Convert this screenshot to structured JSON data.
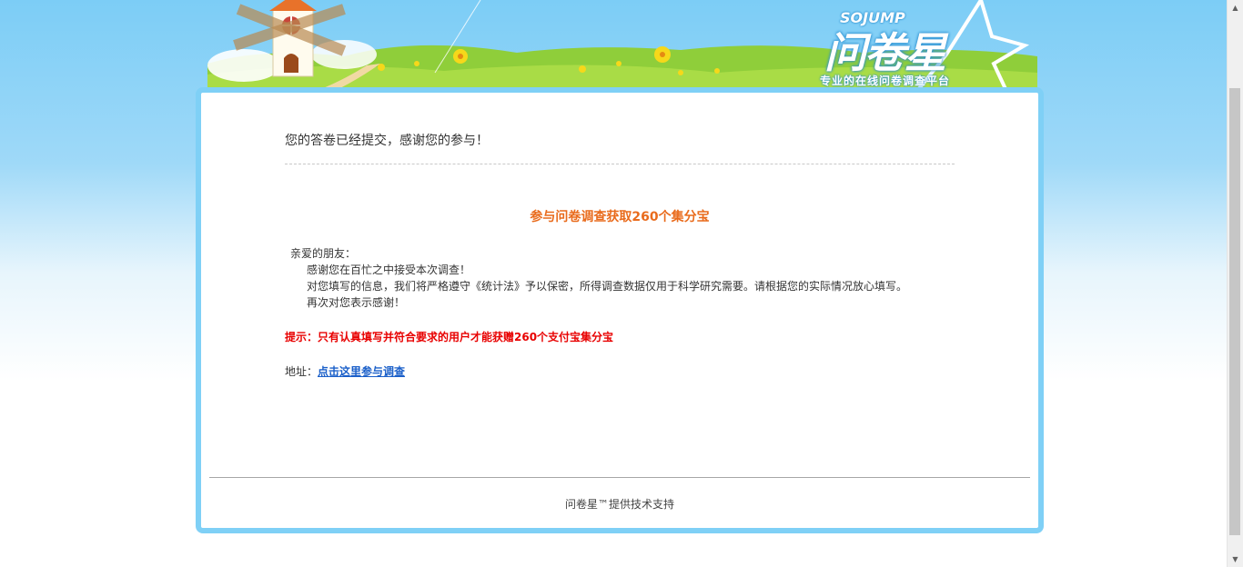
{
  "header": {
    "logo_en": "SOJUMP",
    "logo_cn": "问卷星",
    "logo_tagline": "专业的在线问卷调查平台"
  },
  "main": {
    "submitted_message": "您的答卷已经提交，感谢您的参与！",
    "promo_title": "参与问卷调查获取260个集分宝",
    "letter": {
      "greeting": "亲爱的朋友：",
      "line1": "感谢您在百忙之中接受本次调查！",
      "line2": "对您填写的信息，我们将严格遵守《统计法》予以保密，所得调查数据仅用于科学研究需要。请根据您的实际情况放心填写。",
      "line3": "再次对您表示感谢！"
    },
    "tip": "提示：只有认真填写并符合要求的用户才能获赠260个支付宝集分宝",
    "address_label": "地址：",
    "address_link": "点击这里参与调查"
  },
  "footer": {
    "text": "问卷星™提供技术支持"
  },
  "colors": {
    "promo_title": "#e96b1c",
    "tip": "#e80000",
    "link": "#1a5fc9",
    "card_border": "#7fd0f6"
  },
  "icons": {
    "scroll_up": "triangle-up-icon",
    "scroll_down": "triangle-down-icon"
  }
}
